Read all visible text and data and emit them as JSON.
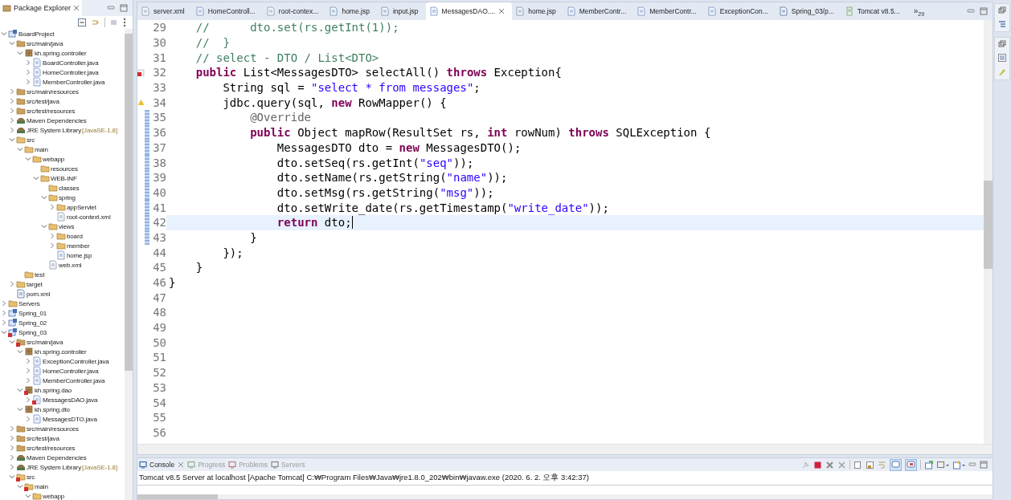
{
  "package_explorer": {
    "title": "Package Explorer",
    "tree": [
      {
        "label": "BoardProject",
        "kind": "project",
        "error": false,
        "expanded": true,
        "children": [
          {
            "label": "src/main/java",
            "kind": "srcfolder",
            "error": false,
            "expanded": true,
            "children": [
              {
                "label": "kh.spring.controller",
                "kind": "package",
                "error": false,
                "expanded": true,
                "children": [
                  {
                    "label": "BoardController.java",
                    "kind": "java",
                    "error": false,
                    "expanded": false
                  },
                  {
                    "label": "HomeController.java",
                    "kind": "java",
                    "error": false,
                    "expanded": false
                  },
                  {
                    "label": "MemberController.java",
                    "kind": "java",
                    "error": false,
                    "expanded": false
                  }
                ]
              }
            ]
          },
          {
            "label": "src/main/resources",
            "kind": "srcfolder",
            "error": false,
            "expanded": false
          },
          {
            "label": "src/test/java",
            "kind": "srcfolder",
            "error": false,
            "expanded": false
          },
          {
            "label": "src/test/resources",
            "kind": "srcfolder",
            "error": false,
            "expanded": false
          },
          {
            "label": "Maven Dependencies",
            "kind": "library",
            "error": false,
            "expanded": false
          },
          {
            "label": "JRE System Library",
            "suffix": "[JavaSE-1.8]",
            "kind": "library",
            "error": false,
            "expanded": false
          },
          {
            "label": "src",
            "kind": "folder",
            "error": false,
            "expanded": true,
            "children": [
              {
                "label": "main",
                "kind": "folder",
                "error": false,
                "expanded": true,
                "children": [
                  {
                    "label": "webapp",
                    "kind": "folder",
                    "error": false,
                    "expanded": true,
                    "children": [
                      {
                        "label": "resources",
                        "kind": "folder",
                        "error": false
                      },
                      {
                        "label": "WEB-INF",
                        "kind": "folder",
                        "error": false,
                        "expanded": true,
                        "children": [
                          {
                            "label": "classes",
                            "kind": "folder",
                            "error": false
                          },
                          {
                            "label": "spring",
                            "kind": "folder",
                            "error": false,
                            "expanded": true,
                            "children": [
                              {
                                "label": "appServlet",
                                "kind": "folder",
                                "error": false,
                                "expanded": false
                              },
                              {
                                "label": "root-context.xml",
                                "kind": "xml",
                                "error": false
                              }
                            ]
                          },
                          {
                            "label": "views",
                            "kind": "folder",
                            "error": false,
                            "expanded": true,
                            "children": [
                              {
                                "label": "board",
                                "kind": "folder",
                                "error": false,
                                "expanded": false
                              },
                              {
                                "label": "member",
                                "kind": "folder",
                                "error": false,
                                "expanded": false
                              },
                              {
                                "label": "home.jsp",
                                "kind": "jsp",
                                "error": false
                              }
                            ]
                          },
                          {
                            "label": "web.xml",
                            "kind": "xml",
                            "error": false
                          }
                        ]
                      }
                    ]
                  }
                ]
              },
              {
                "label": "test",
                "kind": "folder",
                "error": false
              }
            ]
          },
          {
            "label": "target",
            "kind": "folder",
            "error": false,
            "expanded": false
          },
          {
            "label": "pom.xml",
            "kind": "pom",
            "error": false
          }
        ]
      },
      {
        "label": "Servers",
        "kind": "folder",
        "error": false,
        "expanded": false
      },
      {
        "label": "Spring_01",
        "kind": "project",
        "error": false,
        "expanded": false
      },
      {
        "label": "Spring_02",
        "kind": "project",
        "error": false,
        "expanded": false
      },
      {
        "label": "Spring_03",
        "kind": "project",
        "error": true,
        "expanded": true,
        "children": [
          {
            "label": "src/main/java",
            "kind": "srcfolder",
            "error": true,
            "expanded": true,
            "children": [
              {
                "label": "kh.spring.controller",
                "kind": "package",
                "error": false,
                "expanded": true,
                "children": [
                  {
                    "label": "ExceptionController.java",
                    "kind": "java",
                    "error": false,
                    "expanded": false
                  },
                  {
                    "label": "HomeController.java",
                    "kind": "java",
                    "error": false,
                    "expanded": false
                  },
                  {
                    "label": "MemberController.java",
                    "kind": "java",
                    "error": false,
                    "expanded": false
                  }
                ]
              },
              {
                "label": "kh.spring.dao",
                "kind": "package",
                "error": true,
                "expanded": true,
                "children": [
                  {
                    "label": "MessagesDAO.java",
                    "kind": "java",
                    "error": true,
                    "expanded": false
                  }
                ]
              },
              {
                "label": "kh.spring.dto",
                "kind": "package",
                "error": false,
                "expanded": true,
                "children": [
                  {
                    "label": "MessagesDTO.java",
                    "kind": "java",
                    "error": false,
                    "expanded": false
                  }
                ]
              }
            ]
          },
          {
            "label": "src/main/resources",
            "kind": "srcfolder",
            "error": false,
            "expanded": false
          },
          {
            "label": "src/test/java",
            "kind": "srcfolder",
            "error": false,
            "expanded": false
          },
          {
            "label": "src/test/resources",
            "kind": "srcfolder",
            "error": false,
            "expanded": false
          },
          {
            "label": "Maven Dependencies",
            "kind": "library",
            "error": false,
            "expanded": false
          },
          {
            "label": "JRE System Library",
            "suffix": "[JavaSE-1.8]",
            "kind": "library",
            "error": false,
            "expanded": false
          },
          {
            "label": "src",
            "kind": "folder",
            "error": true,
            "expanded": true,
            "children": [
              {
                "label": "main",
                "kind": "folder",
                "error": true,
                "expanded": true,
                "children": [
                  {
                    "label": "webapp",
                    "kind": "folder",
                    "error": false,
                    "expanded": true
                  }
                ]
              }
            ]
          }
        ]
      }
    ]
  },
  "editor_tabs": [
    {
      "label": "server.xml",
      "kind": "xml",
      "selected": false
    },
    {
      "label": "HomeControll...",
      "kind": "java",
      "selected": false
    },
    {
      "label": "root-contex...",
      "kind": "xml",
      "selected": false
    },
    {
      "label": "home.jsp",
      "kind": "jsp",
      "selected": false
    },
    {
      "label": "input.jsp",
      "kind": "jsp",
      "selected": false
    },
    {
      "label": "MessagesDAO....",
      "kind": "java",
      "selected": true
    },
    {
      "label": "home.jsp",
      "kind": "jsp",
      "selected": false
    },
    {
      "label": "MemberContr...",
      "kind": "java",
      "selected": false
    },
    {
      "label": "MemberContr...",
      "kind": "java",
      "selected": false
    },
    {
      "label": "ExceptionCon...",
      "kind": "java",
      "selected": false
    },
    {
      "label": "Spring_03/p...",
      "kind": "pom",
      "selected": false
    },
    {
      "label": "Tomcat v8.5...",
      "kind": "server",
      "selected": false
    }
  ],
  "tab_overflow": {
    "symbol": "»",
    "count": "29"
  },
  "code_lines": [
    {
      "number": "29",
      "kind": "normal",
      "current": false,
      "changed": false,
      "tokens": [
        {
          "kind": "comment",
          "text": "    //      dto.set(rs.getInt(1));"
        }
      ]
    },
    {
      "number": "30",
      "kind": "normal",
      "current": false,
      "changed": false,
      "tokens": [
        {
          "kind": "comment",
          "text": "    //  }"
        }
      ]
    },
    {
      "number": "31",
      "kind": "normal",
      "current": false,
      "changed": false,
      "tokens": [
        {
          "kind": "comment",
          "text": "    // select - DTO / List<DTO>"
        }
      ]
    },
    {
      "number": "32",
      "kind": "error",
      "current": false,
      "changed": false,
      "tokens": [
        {
          "kind": "keyword",
          "text": "    public"
        },
        {
          "kind": "plain",
          "text": " List<MessagesDTO> selectAll() "
        },
        {
          "kind": "keyword",
          "text": "throws"
        },
        {
          "kind": "plain",
          "text": " Exception{"
        }
      ]
    },
    {
      "number": "33",
      "kind": "normal",
      "current": false,
      "changed": false,
      "tokens": [
        {
          "kind": "plain",
          "text": "        String sql = "
        },
        {
          "kind": "string",
          "text": "\"select * from messages\""
        },
        {
          "kind": "plain",
          "text": ";"
        }
      ]
    },
    {
      "number": "34",
      "kind": "warning",
      "current": false,
      "changed": false,
      "tokens": [
        {
          "kind": "plain",
          "text": "        jdbc.query(sql, "
        },
        {
          "kind": "keyword",
          "text": "new"
        },
        {
          "kind": "plain",
          "text": " RowMapper() {"
        }
      ]
    },
    {
      "number": "35",
      "kind": "normal",
      "current": false,
      "changed": true,
      "tokens": [
        {
          "kind": "annotation",
          "text": "            @Override"
        }
      ]
    },
    {
      "number": "36",
      "kind": "normal",
      "current": false,
      "changed": true,
      "tokens": [
        {
          "kind": "keyword",
          "text": "            public"
        },
        {
          "kind": "plain",
          "text": " Object mapRow(ResultSet rs, "
        },
        {
          "kind": "keyword",
          "text": "int"
        },
        {
          "kind": "plain",
          "text": " rowNum) "
        },
        {
          "kind": "keyword",
          "text": "throws"
        },
        {
          "kind": "plain",
          "text": " SQLException {"
        }
      ]
    },
    {
      "number": "37",
      "kind": "normal",
      "current": false,
      "changed": true,
      "tokens": [
        {
          "kind": "plain",
          "text": "                MessagesDTO dto = "
        },
        {
          "kind": "keyword",
          "text": "new"
        },
        {
          "kind": "plain",
          "text": " MessagesDTO();"
        }
      ]
    },
    {
      "number": "38",
      "kind": "normal",
      "current": false,
      "changed": true,
      "tokens": [
        {
          "kind": "plain",
          "text": "                dto.setSeq(rs.getInt("
        },
        {
          "kind": "string",
          "text": "\"seq\""
        },
        {
          "kind": "plain",
          "text": "));"
        }
      ]
    },
    {
      "number": "39",
      "kind": "normal",
      "current": false,
      "changed": true,
      "tokens": [
        {
          "kind": "plain",
          "text": "                dto.setName(rs.getString("
        },
        {
          "kind": "string",
          "text": "\"name\""
        },
        {
          "kind": "plain",
          "text": "));"
        }
      ]
    },
    {
      "number": "40",
      "kind": "normal",
      "current": false,
      "changed": true,
      "tokens": [
        {
          "kind": "plain",
          "text": "                dto.setMsg(rs.getString("
        },
        {
          "kind": "string",
          "text": "\"msg\""
        },
        {
          "kind": "plain",
          "text": "));"
        }
      ]
    },
    {
      "number": "41",
      "kind": "normal",
      "current": false,
      "changed": true,
      "tokens": [
        {
          "kind": "plain",
          "text": "                dto.setWrite_date(rs.getTimestamp("
        },
        {
          "kind": "string",
          "text": "\"write_date\""
        },
        {
          "kind": "plain",
          "text": "));"
        }
      ]
    },
    {
      "number": "42",
      "kind": "normal",
      "current": true,
      "changed": true,
      "tokens": [
        {
          "kind": "keyword",
          "text": "                return"
        },
        {
          "kind": "plain",
          "text": " dto;"
        }
      ]
    },
    {
      "number": "43",
      "kind": "normal",
      "current": false,
      "changed": true,
      "tokens": [
        {
          "kind": "plain",
          "text": "            }"
        }
      ]
    },
    {
      "number": "44",
      "kind": "normal",
      "current": false,
      "changed": false,
      "tokens": [
        {
          "kind": "plain",
          "text": "        });"
        }
      ]
    },
    {
      "number": "45",
      "kind": "normal",
      "current": false,
      "changed": false,
      "tokens": [
        {
          "kind": "plain",
          "text": "    }"
        }
      ]
    },
    {
      "number": "46",
      "kind": "normal",
      "current": false,
      "changed": false,
      "tokens": [
        {
          "kind": "plain",
          "text": "}"
        }
      ]
    },
    {
      "number": "47",
      "kind": "normal",
      "current": false,
      "changed": false
    },
    {
      "number": "48",
      "kind": "normal",
      "current": false,
      "changed": false
    },
    {
      "number": "49",
      "kind": "normal",
      "current": false,
      "changed": false
    },
    {
      "number": "50",
      "kind": "normal",
      "current": false,
      "changed": false
    },
    {
      "number": "51",
      "kind": "normal",
      "current": false,
      "changed": false
    },
    {
      "number": "52",
      "kind": "normal",
      "current": false,
      "changed": false
    },
    {
      "number": "53",
      "kind": "normal",
      "current": false,
      "changed": false
    },
    {
      "number": "54",
      "kind": "normal",
      "current": false,
      "changed": false
    },
    {
      "number": "55",
      "kind": "normal",
      "current": false,
      "changed": false
    },
    {
      "number": "56",
      "kind": "normal",
      "current": false,
      "changed": false
    }
  ],
  "console": {
    "tabs": [
      {
        "label": "Console",
        "kind": "console",
        "selected": true
      },
      {
        "label": "Progress",
        "kind": "progress",
        "selected": false
      },
      {
        "label": "Problems",
        "kind": "problems",
        "selected": false
      },
      {
        "label": "Servers",
        "kind": "servers",
        "selected": false
      }
    ],
    "output": "Tomcat v8.5 Server at localhost [Apache Tomcat] C:₩Program Files₩Java₩jre1.8.0_202₩bin₩javaw.exe (2020. 6. 2. 오후 3:42:37)"
  }
}
